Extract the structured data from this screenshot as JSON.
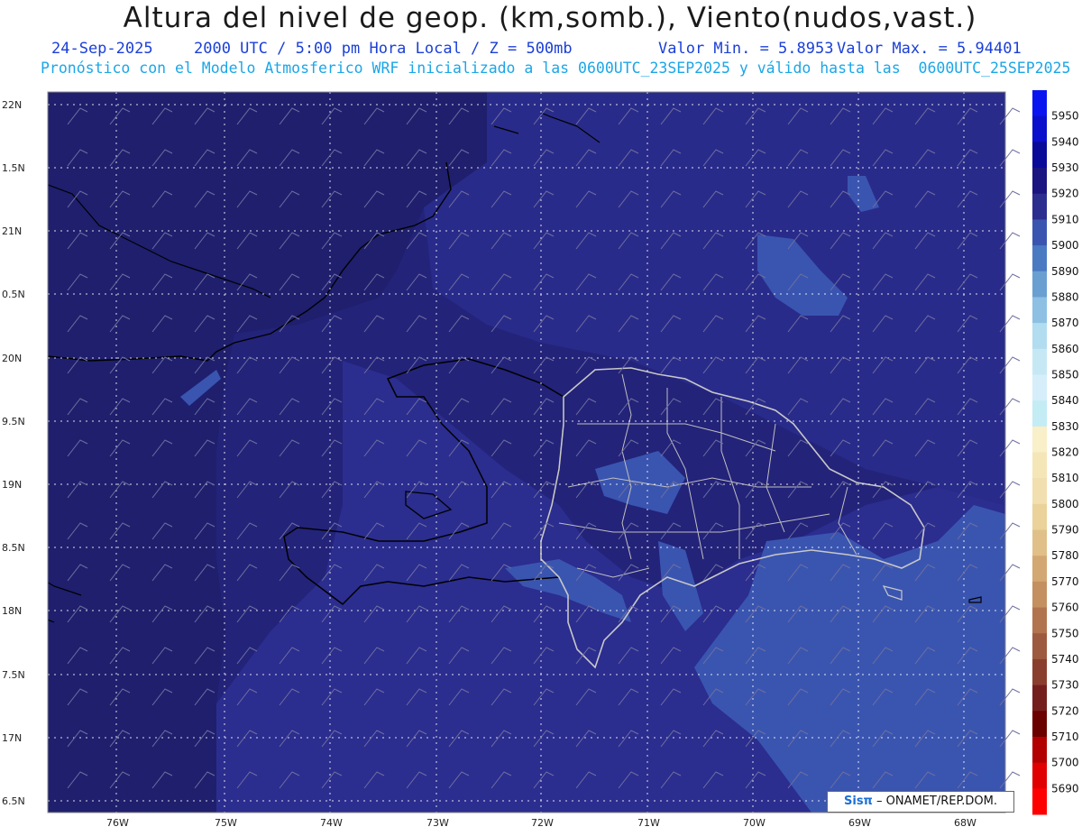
{
  "header": {
    "title": "Altura del nivel de geop. (km,somb.), Viento(nudos,vast.)",
    "date": "24-Sep-2025",
    "time": "2000 UTC / 5:00 pm Hora Local / Z = 500mb",
    "min": "Valor Min. = 5.8953",
    "max": "Valor Max. = 5.94401",
    "forecast": "Pronóstico con el Modelo Atmosferico WRF inicializado a las 0600UTC_23SEP2025 y válido hasta las  0600UTC_25SEP2025"
  },
  "map": {
    "lat_labels": [
      "22N",
      "1.5N",
      "21N",
      "0.5N",
      "20N",
      "9.5N",
      "19N",
      "8.5N",
      "18N",
      "7.5N",
      "17N",
      "6.5N"
    ],
    "lon_labels": [
      "76W",
      "75W",
      "74W",
      "73W",
      "72W",
      "71W",
      "70W",
      "69W",
      "68W"
    ]
  },
  "colorbar": {
    "levels": [
      "5950",
      "5940",
      "5930",
      "5920",
      "5910",
      "5900",
      "5890",
      "5880",
      "5870",
      "5860",
      "5850",
      "5840",
      "5830",
      "5820",
      "5810",
      "5800",
      "5790",
      "5780",
      "5770",
      "5760",
      "5750",
      "5740",
      "5730",
      "5720",
      "5710",
      "5700",
      "5690"
    ],
    "colors": [
      "#0a14f0",
      "#0a0fcc",
      "#0a0a99",
      "#1a1580",
      "#2b2d8f",
      "#3a55b0",
      "#4a7ac2",
      "#6a9fd2",
      "#8dc0e3",
      "#b2dcf0",
      "#c6e8f5",
      "#d6eef9",
      "#c3ecf5",
      "#f9efc8",
      "#f5e6b8",
      "#f2dfaf",
      "#ead29a",
      "#e0c088",
      "#d3a772",
      "#c49060",
      "#b2744e",
      "#9e5a3e",
      "#8a3f2e",
      "#751e1e",
      "#6b0000",
      "#b20000",
      "#e00000",
      "#ff0000"
    ]
  },
  "credit": {
    "logo": "Sisπ",
    "text": " – ONAMET/REP.DOM."
  }
}
